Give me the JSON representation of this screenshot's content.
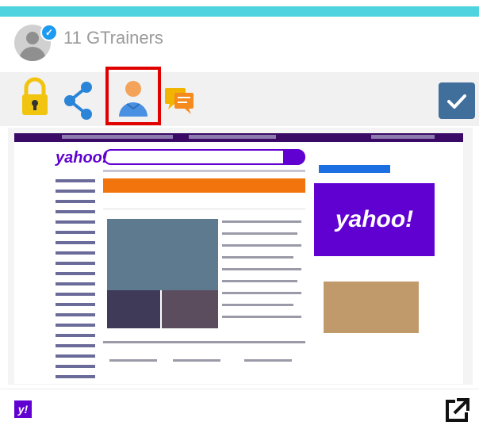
{
  "header": {
    "username": "11 GTrainers",
    "verified_mark": "✓"
  },
  "toolbar": {
    "icons": [
      "lock-icon",
      "share-icon",
      "user-icon",
      "chat-icon",
      "checkbox-icon"
    ],
    "selected": "user-icon"
  },
  "preview": {
    "site_logo": "yahoo!",
    "ad_logo": "yahoo!"
  },
  "footer": {
    "badge_text": "y!"
  },
  "colors": {
    "topbar": "#4fd3de",
    "accent_red": "#e00000",
    "yahoo_purple": "#6001d2",
    "check_blue": "#3f6f9a"
  }
}
